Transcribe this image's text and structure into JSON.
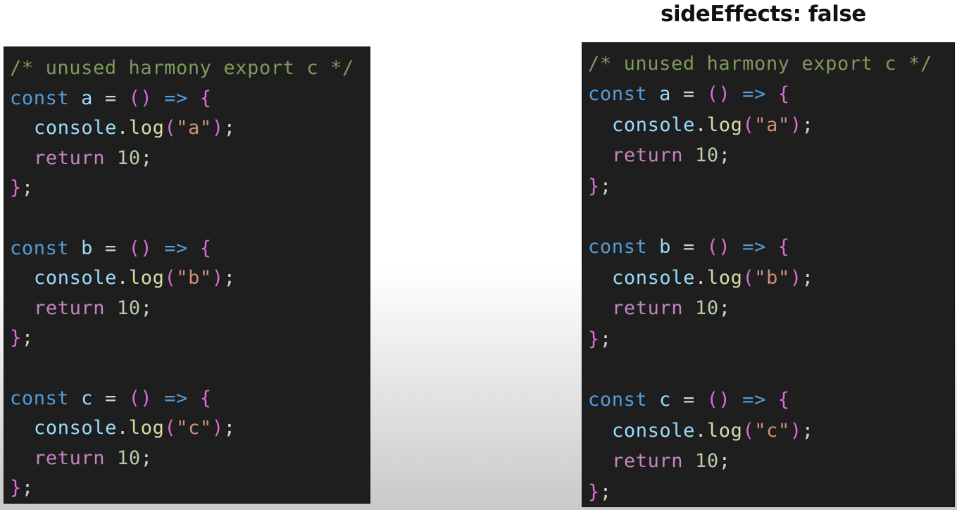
{
  "caption": "sideEffects: false",
  "panels": [
    {
      "id": "left",
      "lines": [
        [
          {
            "t": "/* unused harmony export c */",
            "c": "t-comment"
          }
        ],
        [
          {
            "t": "const",
            "c": "t-kw"
          },
          {
            "t": " a",
            "c": "t-var"
          },
          {
            "t": " =",
            "c": "t-op"
          },
          {
            "t": " ()",
            "c": "t-paren"
          },
          {
            "t": " =>",
            "c": "t-kw"
          },
          {
            "t": " {",
            "c": "t-brace"
          }
        ],
        [
          {
            "indent": true
          },
          {
            "t": "console",
            "c": "t-obj"
          },
          {
            "t": ".",
            "c": "t-punct"
          },
          {
            "t": "log",
            "c": "t-fn"
          },
          {
            "t": "(",
            "c": "t-paren"
          },
          {
            "t": "\"a\"",
            "c": "t-str"
          },
          {
            "t": ")",
            "c": "t-paren"
          },
          {
            "t": ";",
            "c": "t-punct"
          }
        ],
        [
          {
            "indent": true
          },
          {
            "t": "return",
            "c": "t-ret"
          },
          {
            "t": " 10",
            "c": "t-num"
          },
          {
            "t": ";",
            "c": "t-punct"
          }
        ],
        [
          {
            "t": "}",
            "c": "t-brace"
          },
          {
            "t": ";",
            "c": "t-punct"
          }
        ],
        [],
        [
          {
            "t": "const",
            "c": "t-kw"
          },
          {
            "t": " b",
            "c": "t-var"
          },
          {
            "t": " =",
            "c": "t-op"
          },
          {
            "t": " ()",
            "c": "t-paren"
          },
          {
            "t": " =>",
            "c": "t-kw"
          },
          {
            "t": " {",
            "c": "t-brace"
          }
        ],
        [
          {
            "indent": true
          },
          {
            "t": "console",
            "c": "t-obj"
          },
          {
            "t": ".",
            "c": "t-punct"
          },
          {
            "t": "log",
            "c": "t-fn"
          },
          {
            "t": "(",
            "c": "t-paren"
          },
          {
            "t": "\"b\"",
            "c": "t-str"
          },
          {
            "t": ")",
            "c": "t-paren"
          },
          {
            "t": ";",
            "c": "t-punct"
          }
        ],
        [
          {
            "indent": true
          },
          {
            "t": "return",
            "c": "t-ret"
          },
          {
            "t": " 10",
            "c": "t-num"
          },
          {
            "t": ";",
            "c": "t-punct"
          }
        ],
        [
          {
            "t": "}",
            "c": "t-brace"
          },
          {
            "t": ";",
            "c": "t-punct"
          }
        ],
        [],
        [
          {
            "t": "const",
            "c": "t-kw"
          },
          {
            "t": " c",
            "c": "t-var"
          },
          {
            "t": " =",
            "c": "t-op"
          },
          {
            "t": " ()",
            "c": "t-paren"
          },
          {
            "t": " =>",
            "c": "t-kw"
          },
          {
            "t": " {",
            "c": "t-brace"
          }
        ],
        [
          {
            "indent": true
          },
          {
            "t": "console",
            "c": "t-obj"
          },
          {
            "t": ".",
            "c": "t-punct"
          },
          {
            "t": "log",
            "c": "t-fn"
          },
          {
            "t": "(",
            "c": "t-paren"
          },
          {
            "t": "\"c\"",
            "c": "t-str"
          },
          {
            "t": ")",
            "c": "t-paren"
          },
          {
            "t": ";",
            "c": "t-punct"
          }
        ],
        [
          {
            "indent": true
          },
          {
            "t": "return",
            "c": "t-ret"
          },
          {
            "t": " 10",
            "c": "t-num"
          },
          {
            "t": ";",
            "c": "t-punct"
          }
        ],
        [
          {
            "t": "}",
            "c": "t-brace"
          },
          {
            "t": ";",
            "c": "t-punct"
          }
        ]
      ]
    },
    {
      "id": "right",
      "lines": [
        [
          {
            "t": "/* unused harmony export c */",
            "c": "t-comment"
          }
        ],
        [
          {
            "t": "const",
            "c": "t-kw"
          },
          {
            "t": " a",
            "c": "t-var"
          },
          {
            "t": " =",
            "c": "t-op"
          },
          {
            "t": " ()",
            "c": "t-paren"
          },
          {
            "t": " =>",
            "c": "t-kw"
          },
          {
            "t": " {",
            "c": "t-brace"
          }
        ],
        [
          {
            "indent": true
          },
          {
            "t": "console",
            "c": "t-obj"
          },
          {
            "t": ".",
            "c": "t-punct"
          },
          {
            "t": "log",
            "c": "t-fn"
          },
          {
            "t": "(",
            "c": "t-paren"
          },
          {
            "t": "\"a\"",
            "c": "t-str"
          },
          {
            "t": ")",
            "c": "t-paren"
          },
          {
            "t": ";",
            "c": "t-punct"
          }
        ],
        [
          {
            "indent": true
          },
          {
            "t": "return",
            "c": "t-ret"
          },
          {
            "t": " 10",
            "c": "t-num"
          },
          {
            "t": ";",
            "c": "t-punct"
          }
        ],
        [
          {
            "t": "}",
            "c": "t-brace"
          },
          {
            "t": ";",
            "c": "t-punct"
          }
        ],
        [],
        [
          {
            "t": "const",
            "c": "t-kw"
          },
          {
            "t": " b",
            "c": "t-var"
          },
          {
            "t": " =",
            "c": "t-op"
          },
          {
            "t": " ()",
            "c": "t-paren"
          },
          {
            "t": " =>",
            "c": "t-kw"
          },
          {
            "t": " {",
            "c": "t-brace"
          }
        ],
        [
          {
            "indent": true
          },
          {
            "t": "console",
            "c": "t-obj"
          },
          {
            "t": ".",
            "c": "t-punct"
          },
          {
            "t": "log",
            "c": "t-fn"
          },
          {
            "t": "(",
            "c": "t-paren"
          },
          {
            "t": "\"b\"",
            "c": "t-str"
          },
          {
            "t": ")",
            "c": "t-paren"
          },
          {
            "t": ";",
            "c": "t-punct"
          }
        ],
        [
          {
            "indent": true
          },
          {
            "t": "return",
            "c": "t-ret"
          },
          {
            "t": " 10",
            "c": "t-num"
          },
          {
            "t": ";",
            "c": "t-punct"
          }
        ],
        [
          {
            "t": "}",
            "c": "t-brace"
          },
          {
            "t": ";",
            "c": "t-punct"
          }
        ],
        [],
        [
          {
            "t": "const",
            "c": "t-kw"
          },
          {
            "t": " c",
            "c": "t-var"
          },
          {
            "t": " =",
            "c": "t-op"
          },
          {
            "t": " ()",
            "c": "t-paren"
          },
          {
            "t": " =>",
            "c": "t-kw"
          },
          {
            "t": " {",
            "c": "t-brace"
          }
        ],
        [
          {
            "indent": true
          },
          {
            "t": "console",
            "c": "t-obj"
          },
          {
            "t": ".",
            "c": "t-punct"
          },
          {
            "t": "log",
            "c": "t-fn"
          },
          {
            "t": "(",
            "c": "t-paren"
          },
          {
            "t": "\"c\"",
            "c": "t-str"
          },
          {
            "t": ")",
            "c": "t-paren"
          },
          {
            "t": ";",
            "c": "t-punct"
          }
        ],
        [
          {
            "indent": true
          },
          {
            "t": "return",
            "c": "t-ret"
          },
          {
            "t": " 10",
            "c": "t-num"
          },
          {
            "t": ";",
            "c": "t-punct"
          }
        ],
        [
          {
            "t": "}",
            "c": "t-brace"
          },
          {
            "t": ";",
            "c": "t-punct"
          }
        ]
      ]
    }
  ]
}
